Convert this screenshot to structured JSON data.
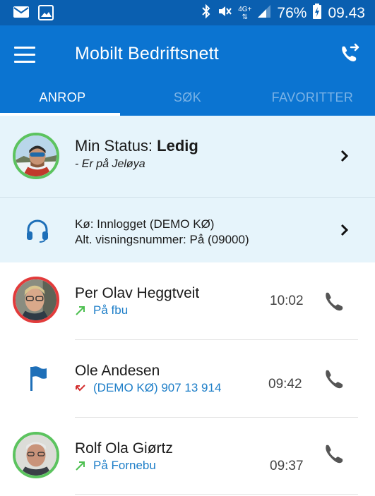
{
  "status_bar": {
    "battery_pct": "76%",
    "time": "09.43",
    "network": "4G+",
    "icons": [
      "mail-icon",
      "image-icon",
      "bluetooth-icon",
      "mute-icon",
      "signal-icon",
      "battery-charging-icon"
    ]
  },
  "app_bar": {
    "title": "Mobilt Bedriftsnett",
    "menu_icon": "hamburger-menu-icon",
    "action_icon": "call-transfer-icon"
  },
  "tabs": [
    {
      "label": "ANROP",
      "active": true
    },
    {
      "label": "SØK",
      "active": false
    },
    {
      "label": "FAVORITTER",
      "active": false
    }
  ],
  "my_status": {
    "prefix": "Min Status:",
    "value": "Ledig",
    "note": "- Er på Jeløya"
  },
  "queue": {
    "line1": "Kø: Innlogget (DEMO KØ)",
    "line2": "Alt. visningsnummer: På (09000)"
  },
  "calls": [
    {
      "name": "Per Olav Heggtveit",
      "detail": "På fbu",
      "time": "10:02",
      "direction": "outgoing",
      "status": "busy"
    },
    {
      "name": "Ole Andesen",
      "detail": "(DEMO KØ) 907 13 914",
      "time": "09:42",
      "direction": "missed",
      "status": "none"
    },
    {
      "name": "Rolf Ola Giørtz",
      "detail": "På Fornebu",
      "time": "09:37",
      "direction": "outgoing",
      "status": "available"
    }
  ],
  "colors": {
    "status_bar": "#0a5fb0",
    "app_bar": "#0b74d1",
    "status_bg": "#e6f4fb",
    "available": "#5cc35f",
    "busy": "#e23b3b",
    "link_blue": "#1d7ec8"
  }
}
